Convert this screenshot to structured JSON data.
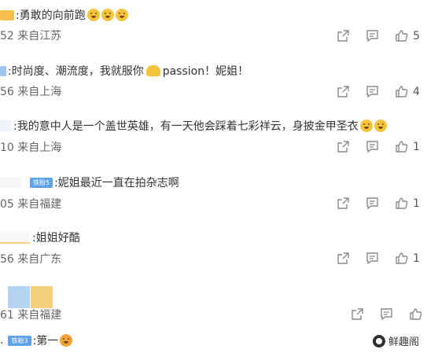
{
  "comments": [
    {
      "text": ":勇敢的向前跑",
      "badge": "",
      "count_fragment": "52",
      "location": "来自江苏",
      "likes": "5"
    },
    {
      "text": ":时尚度、潮流度，我就服你",
      "text_tail": " passion！妮姐！",
      "count_fragment": "56",
      "location": "来自上海",
      "likes": "4"
    },
    {
      "text": ":我的意中人是一个盖世英雄，有一天他会踩着七彩祥云，身披金甲圣衣",
      "count_fragment": "10",
      "location": "来自上海",
      "likes": "1"
    },
    {
      "badge": "铁粉5",
      "text": ":妮姐最近一直在拍杂志啊",
      "count_fragment": "05",
      "location": "来自福建",
      "likes": "1"
    },
    {
      "text": ":姐姐好酷",
      "count_fragment": "56",
      "location": "来自广东",
      "likes": "1"
    },
    {
      "count_fragment": "61",
      "location": "来自福建",
      "likes": ""
    },
    {
      "badge": "铁粉3",
      "text": ":第一",
      "lead": "."
    }
  ],
  "watermark": "鲜趣阁",
  "icons": {
    "share": "share-icon",
    "comment": "comment-icon",
    "like": "thumbs-up-icon"
  }
}
